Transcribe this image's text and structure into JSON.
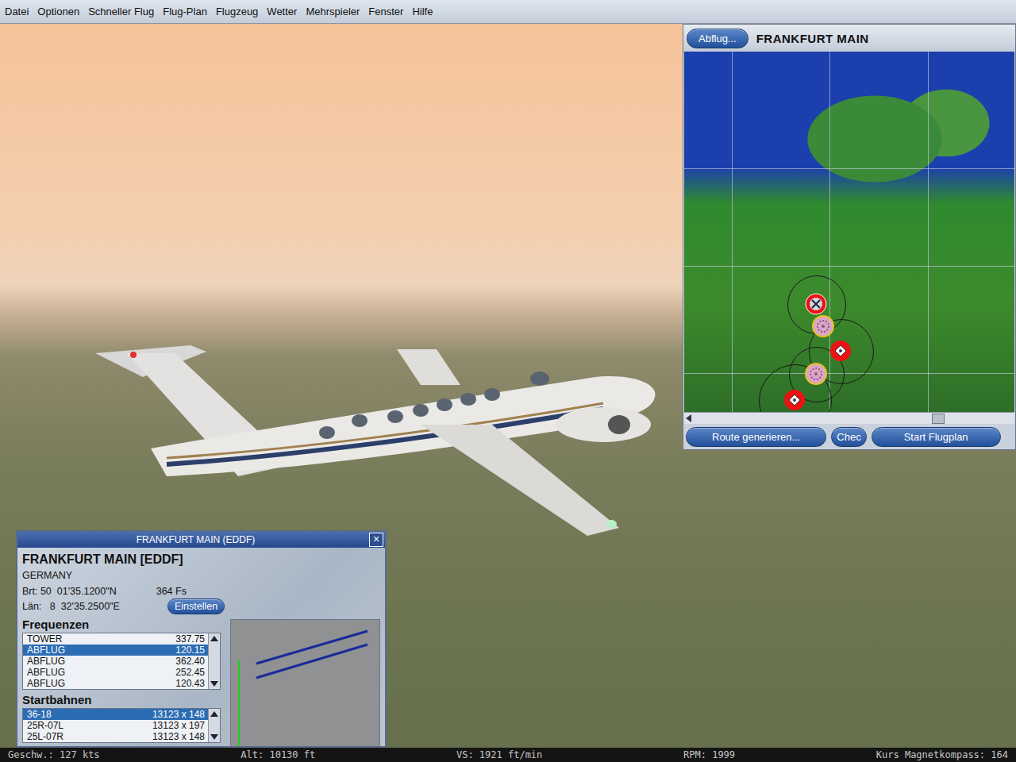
{
  "menu": [
    "Datei",
    "Optionen",
    "Schneller Flug",
    "Flug-Plan",
    "Flugzeug",
    "Wetter",
    "Mehrspieler",
    "Fenster",
    "Hilfe"
  ],
  "map_window": {
    "departure_button": "Abflug...",
    "title": "FRANKFURT MAIN",
    "buttons": [
      "Route generieren...",
      "Chec",
      "Start Flugplan"
    ],
    "markers": [
      {
        "kind": "departure"
      },
      {
        "kind": "ndb"
      },
      {
        "kind": "vor"
      },
      {
        "kind": "ndb"
      },
      {
        "kind": "vor"
      }
    ]
  },
  "airport_window": {
    "title": "FRANKFURT MAIN (EDDF)",
    "close": "×",
    "name": "FRANKFURT MAIN [EDDF]",
    "country": "GERMANY",
    "latitude": "Brt: 50  01'35.1200\"N",
    "elevation": "364 Fs",
    "longitude": "Län:   8  32'35.2500\"E",
    "set_button": "Einstellen",
    "frequencies_label": "Frequenzen",
    "frequencies": [
      {
        "name": "TOWER",
        "value": "337.75",
        "selected": false
      },
      {
        "name": "ABFLUG",
        "value": "120.15",
        "selected": true
      },
      {
        "name": "ABFLUG",
        "value": "362.40",
        "selected": false
      },
      {
        "name": "ABFLUG",
        "value": "252.45",
        "selected": false
      },
      {
        "name": "ABFLUG",
        "value": "120.43",
        "selected": false
      }
    ],
    "runways_label": "Startbahnen",
    "runways": [
      {
        "name": "36-18",
        "size": "13123 x 148",
        "selected": true
      },
      {
        "name": "25R-07L",
        "size": "13123 x 197",
        "selected": false
      },
      {
        "name": "25L-07R",
        "size": "13123 x 148",
        "selected": false
      }
    ]
  },
  "status_bar": [
    "Geschw.: 127 kts",
    "Alt: 10130 ft",
    "VS: 1921 ft/min",
    "RPM: 1999",
    "Kurs Magnetkompass: 164"
  ]
}
